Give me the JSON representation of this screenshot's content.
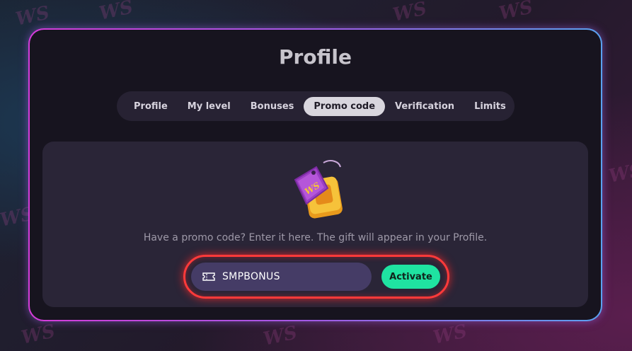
{
  "background": {
    "logo_text": "WS"
  },
  "modal": {
    "title": "Profile",
    "tabs": [
      {
        "label": "Profile",
        "active": false
      },
      {
        "label": "My level",
        "active": false
      },
      {
        "label": "Bonuses",
        "active": false
      },
      {
        "label": "Promo code",
        "active": true
      },
      {
        "label": "Verification",
        "active": false
      },
      {
        "label": "Limits",
        "active": false
      }
    ],
    "promo": {
      "gift_icon": "gift-tag-icon",
      "gift_logo": "WS",
      "prompt": "Have a promo code? Enter it here. The gift will appear in your Profile.",
      "input_icon": "ticket-icon",
      "input_value": "SMPBONUS",
      "activate_label": "Activate"
    }
  },
  "colors": {
    "accent": "#1fe3a1",
    "highlight": "#ff3a3a",
    "modal_border_start": "#d53bd9",
    "modal_border_end": "#5aa2f0"
  }
}
